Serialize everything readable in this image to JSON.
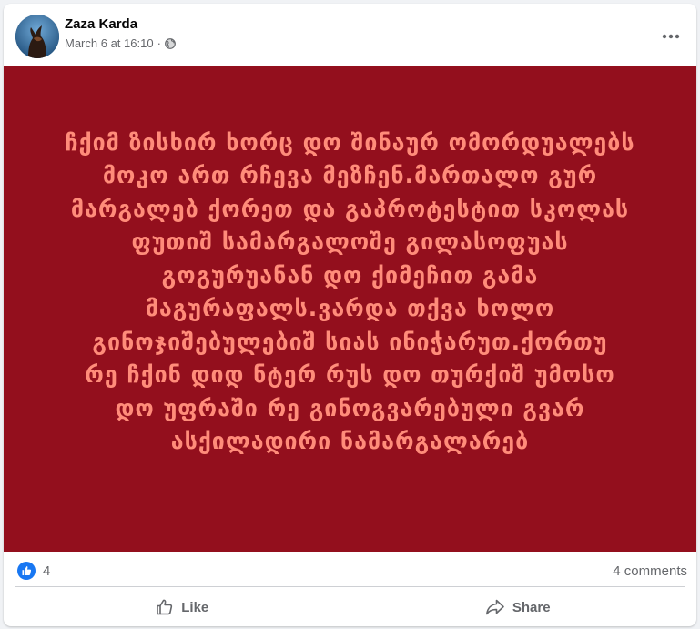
{
  "post": {
    "author": "Zaza Karda",
    "timestamp": "March 6 at 16:10",
    "separator": "·",
    "privacy_icon": "globe-icon",
    "menu_icon": "more-options-icon",
    "text": "ჩქიმ ზისხირ ხორც დო შინაურ ომორდუალებს\nმოკო ართ რჩევა მეზჩენ.მართალო გურ\nმარგალებ ქორეთ და გაპროტესტით სკოლას\nფუთიშ სამარგალოშე გილასოფუას\nგოგურუანან დო ქიმეჩით გამა\nმაგურაფალს.ვარდა თქვა ხოლო\nგინოჯიშებულებიშ სიას ინიჭარუთ.ქორთუ\nრე ჩქინ დიდ ნტერ რუს დო თურქიშ უმოსო\nდო უფრაში რე გინოგვარებული გვარ\nასქილადირი ნამარგალარებ"
  },
  "stats": {
    "reaction_icon": "like-reaction-icon",
    "reactions_count": "4",
    "comments_label": "4 comments"
  },
  "actions": {
    "like_label": "Like",
    "share_label": "Share"
  },
  "colors": {
    "post_background": "#930f1d",
    "post_text": "#ff8c7a",
    "facebook_blue": "#1877f2",
    "secondary_text": "#65676b"
  }
}
